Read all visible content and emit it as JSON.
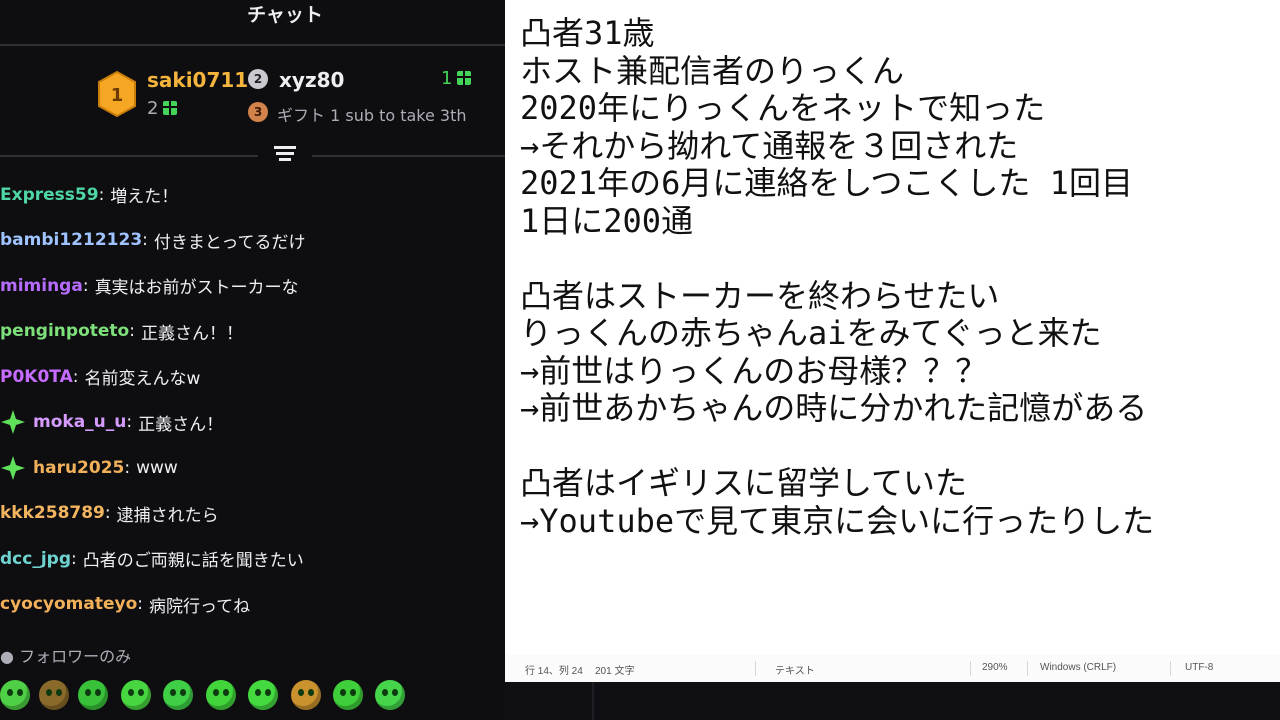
{
  "chat": {
    "title": "チャット",
    "leaderboard": {
      "first": {
        "rank": "1",
        "name": "saki0711",
        "count": "2"
      },
      "second": {
        "rank": "2",
        "name": "xyz80",
        "count": "1"
      },
      "third": {
        "rank": "3",
        "text": "ギフト 1 sub to take 3th"
      }
    },
    "messages": [
      {
        "user": "Express59",
        "color": "#4fd6a5",
        "text": "増えた！",
        "badge": false
      },
      {
        "user": "bambi1212123",
        "color": "#9fc3ff",
        "text": "付きまとってるだけ",
        "badge": false
      },
      {
        "user": "miminga",
        "color": "#b56cff",
        "text": "真実はお前がストーカーな",
        "badge": false
      },
      {
        "user": "penginpoteto",
        "color": "#7ee07a",
        "text": "正義さん！！",
        "badge": false
      },
      {
        "user": "P0K0TA",
        "color": "#c66bff",
        "text": "名前変えんなw",
        "badge": false
      },
      {
        "user": "moka_u_u",
        "color": "#d59bff",
        "text": "正義さん！",
        "badge": true
      },
      {
        "user": "haru2025",
        "color": "#f2b05a",
        "text": "www",
        "badge": true
      },
      {
        "user": "kkk258789",
        "color": "#f4b560",
        "text": "逮捕されたら",
        "badge": false
      },
      {
        "user": "dcc_jpg",
        "color": "#6fd3d0",
        "text": "凸者のご両親に話を聞きたい",
        "badge": false
      },
      {
        "user": "cyocyomateyo",
        "color": "#f2b05a",
        "text": "病院行ってね",
        "badge": false
      }
    ],
    "follower_only": "フォロワーのみ",
    "emotes": [
      "angel-emote",
      "angry-emote",
      "crazy-emote",
      "smile-emote",
      "scared-emote",
      "grin-emote",
      "happy-emote",
      "helmet-emote",
      "laugh-emote",
      "love-emote"
    ]
  },
  "notepad": {
    "lines": [
      "凸者31歳",
      "ホスト兼配信者のりっくん",
      "2020年にりっくんをネットで知った",
      "→それから拗れて通報を３回された",
      "2021年の6月に連絡をしつこくした 1回目",
      "1日に200通",
      "",
      "凸者はストーカーを終わらせたい",
      "りっくんの赤ちゃんaiをみてぐっと来た",
      "→前世はりっくんのお母様？？？",
      "→前世あかちゃんの時に分かれた記憶がある",
      "",
      "凸者はイギリスに留学していた",
      "→Youtubeで見て東京に会いに行ったりした"
    ],
    "status": {
      "position": "行 14、列 24",
      "chars": "201 文字",
      "mode": "テキスト",
      "zoom": "290%",
      "eol": "Windows (CRLF)",
      "encoding": "UTF-8"
    }
  }
}
